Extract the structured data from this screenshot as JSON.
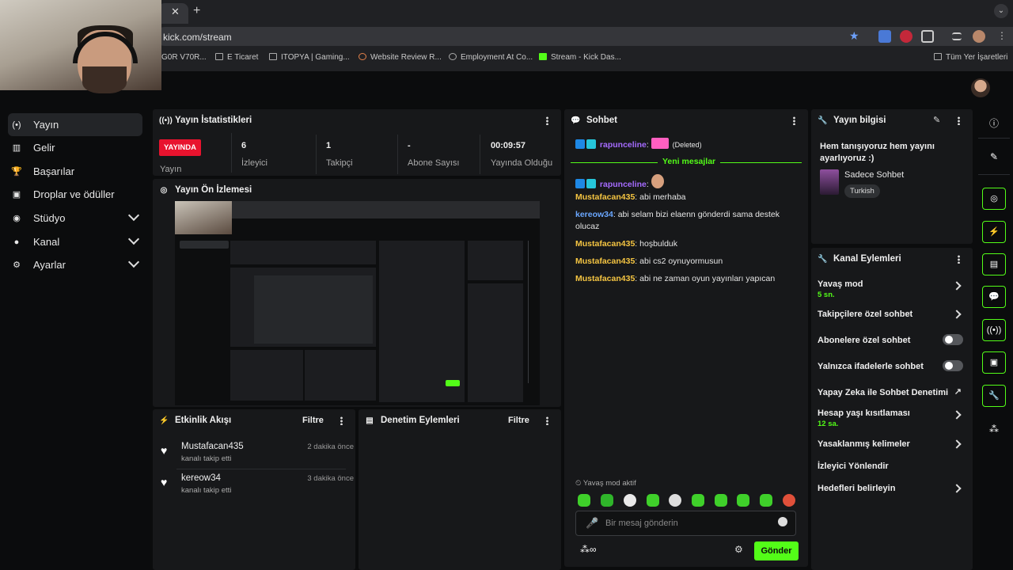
{
  "browser": {
    "url": "kick.com/stream",
    "bookmarks": [
      "G0R V70R...",
      "E Ticaret",
      "ITOPYA | Gaming...",
      "Website Review R...",
      "Employment At Co...",
      "Stream - Kick Das..."
    ],
    "all_bookmarks": "Tüm Yer İşaretleri"
  },
  "sidebar": {
    "items": [
      {
        "label": "Yayın",
        "icon": "stream-icon"
      },
      {
        "label": "Gelir",
        "icon": "chart-icon"
      },
      {
        "label": "Başarılar",
        "icon": "trophy-icon"
      },
      {
        "label": "Droplar ve ödüller",
        "icon": "gift-icon"
      },
      {
        "label": "Stüdyo",
        "icon": "studio-icon"
      },
      {
        "label": "Kanal",
        "icon": "user-icon"
      },
      {
        "label": "Ayarlar",
        "icon": "gear-icon"
      }
    ]
  },
  "stats": {
    "title": "Yayın İstatistikleri",
    "live": "YAYINDA",
    "items": [
      {
        "value": "",
        "label": "Yayın"
      },
      {
        "value": "6",
        "label": "İzleyici"
      },
      {
        "value": "1",
        "label": "Takipçi"
      },
      {
        "value": "-",
        "label": "Abone Sayısı"
      },
      {
        "value": "00:09:57",
        "label": "Yayında Olduğu"
      }
    ]
  },
  "preview": {
    "title": "Yayın Ön İzlemesi"
  },
  "activity": {
    "title": "Etkinlik Akışı",
    "filter": "Filtre",
    "events": [
      {
        "name": "Mustafacan435",
        "sub": "kanalı takip etti",
        "time": "2 dakika önce"
      },
      {
        "name": "kereow34",
        "sub": "kanalı takip etti",
        "time": "3 dakika önce"
      }
    ]
  },
  "moderation": {
    "title": "Denetim Eylemleri",
    "filter": "Filtre"
  },
  "chat": {
    "title": "Sohbet",
    "deleted_user": "rapunceline",
    "deleted_text": "(Deleted)",
    "new_messages": "Yeni mesajlar",
    "sticker_user": "rapunceline",
    "messages": [
      {
        "user": "Mustafacan435",
        "text": "abi merhaba"
      },
      {
        "user": "kereow34",
        "text": "abi selam bizi elaenn gönderdi sama destek olucaz"
      },
      {
        "user": "Mustafacan435",
        "text": "hoşbulduk"
      },
      {
        "user": "Mustafacan435",
        "text": "abi cs2 oynuyormusun"
      },
      {
        "user": "Mustafacan435",
        "text": "abi ne zaman oyun yayınları yapıcan"
      }
    ],
    "slow_mode": "Yavaş mod aktif",
    "placeholder": "Bir mesaj gönderin",
    "send": "Gönder"
  },
  "stream_info": {
    "title": "Yayın bilgisi",
    "stream_title": "Hem tanışıyoruz hem yayını ayarlıyoruz :)",
    "category": "Sadece Sohbet",
    "tag": "Turkish"
  },
  "channel_actions": {
    "title": "Kanal Eylemleri",
    "rows": [
      {
        "label": "Yavaş mod",
        "sub": "5 sn.",
        "type": "arrow"
      },
      {
        "label": "Takipçilere özel sohbet",
        "sub": "",
        "type": "arrow"
      },
      {
        "label": "Abonelere özel sohbet",
        "sub": "",
        "type": "toggle"
      },
      {
        "label": "Yalnızca ifadelerle sohbet",
        "sub": "",
        "type": "toggle"
      },
      {
        "label": "Yapay Zeka ile Sohbet Denetimi",
        "sub": "",
        "type": "external"
      },
      {
        "label": "Hesap yaşı kısıtlaması",
        "sub": "12 sa.",
        "type": "arrow"
      },
      {
        "label": "Yasaklanmış kelimeler",
        "sub": "",
        "type": "arrow"
      },
      {
        "label": "İzleyici Yönlendir",
        "sub": "",
        "type": "none"
      },
      {
        "label": "Hedefleri belirleyin",
        "sub": "",
        "type": "arrow"
      }
    ]
  },
  "colors": {
    "accent": "#53fc18",
    "live": "#e8132e",
    "panel": "#17181a",
    "username": "#f5c542"
  }
}
